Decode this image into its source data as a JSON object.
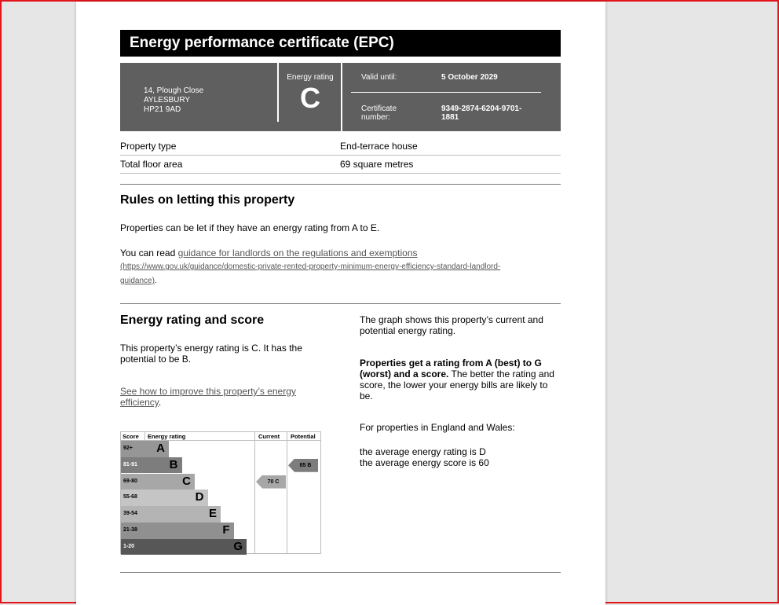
{
  "certificate": {
    "title": "Energy performance certificate (EPC)",
    "address_lines": [
      "14, Plough Close",
      "AYLESBURY",
      "HP21 9AD"
    ],
    "energy_rating_label": "Energy rating",
    "energy_rating": "C",
    "valid_until_label": "Valid until:",
    "valid_until": "5 October 2029",
    "certificate_number_label_lines": [
      "Certificate",
      "number:"
    ],
    "certificate_number_lines": [
      "9349-2874-6204-9701-",
      "1881"
    ]
  },
  "property": [
    {
      "label": "Property type",
      "value": "End-terrace house"
    },
    {
      "label": "Total floor area",
      "value": "69 square metres"
    }
  ],
  "letting": {
    "heading": "Rules on letting this property",
    "text": "Properties can be let if they have an energy rating from A to E.",
    "read_prefix": "You can read ",
    "link_text": "guidance for landlords on the regulations and exemptions",
    "link_url_line1": "(https://www.gov.uk/guidance/domestic-private-rented-property-minimum-energy-efficiency-standard-landlord-",
    "link_url_line2": "guidance)",
    "link_url_suffix": "."
  },
  "score_section": {
    "heading": "Energy rating and score",
    "text": "This property’s energy rating is C. It has the potential to be B.",
    "improve_link": "See how to improve this property’s energy efficiency",
    "improve_suffix": ".",
    "graph_text": "The graph shows this property’s current and potential energy rating.",
    "bold_text": "Properties get a rating from A (best) to G (worst) and a score.",
    "rest_text": " The better the rating and score, the lower your energy bills are likely to be.",
    "england_text": "For properties in England and Wales:",
    "avg_rating": "the average energy rating is D",
    "avg_score": "the average energy score is 60"
  },
  "chart_data": {
    "type": "table",
    "headers": {
      "score": "Score",
      "rating": "Energy rating",
      "current": "Current",
      "potential": "Potential"
    },
    "bands": [
      {
        "score": "92+",
        "letter": "A",
        "color": "#969696"
      },
      {
        "score": "81-91",
        "letter": "B",
        "color": "#7d7d7d"
      },
      {
        "score": "69-80",
        "letter": "C",
        "color": "#a7a7a7"
      },
      {
        "score": "55-68",
        "letter": "D",
        "color": "#c5c5c5"
      },
      {
        "score": "39-54",
        "letter": "E",
        "color": "#b4b4b4"
      },
      {
        "score": "21-38",
        "letter": "F",
        "color": "#909090"
      },
      {
        "score": "1-20",
        "letter": "G",
        "color": "#575757"
      }
    ],
    "current": {
      "score": 70,
      "letter": "C",
      "label": "70  C",
      "color": "#a7a7a7"
    },
    "potential": {
      "score": 85,
      "letter": "B",
      "label": "85  B",
      "color": "#7d7d7d"
    }
  }
}
